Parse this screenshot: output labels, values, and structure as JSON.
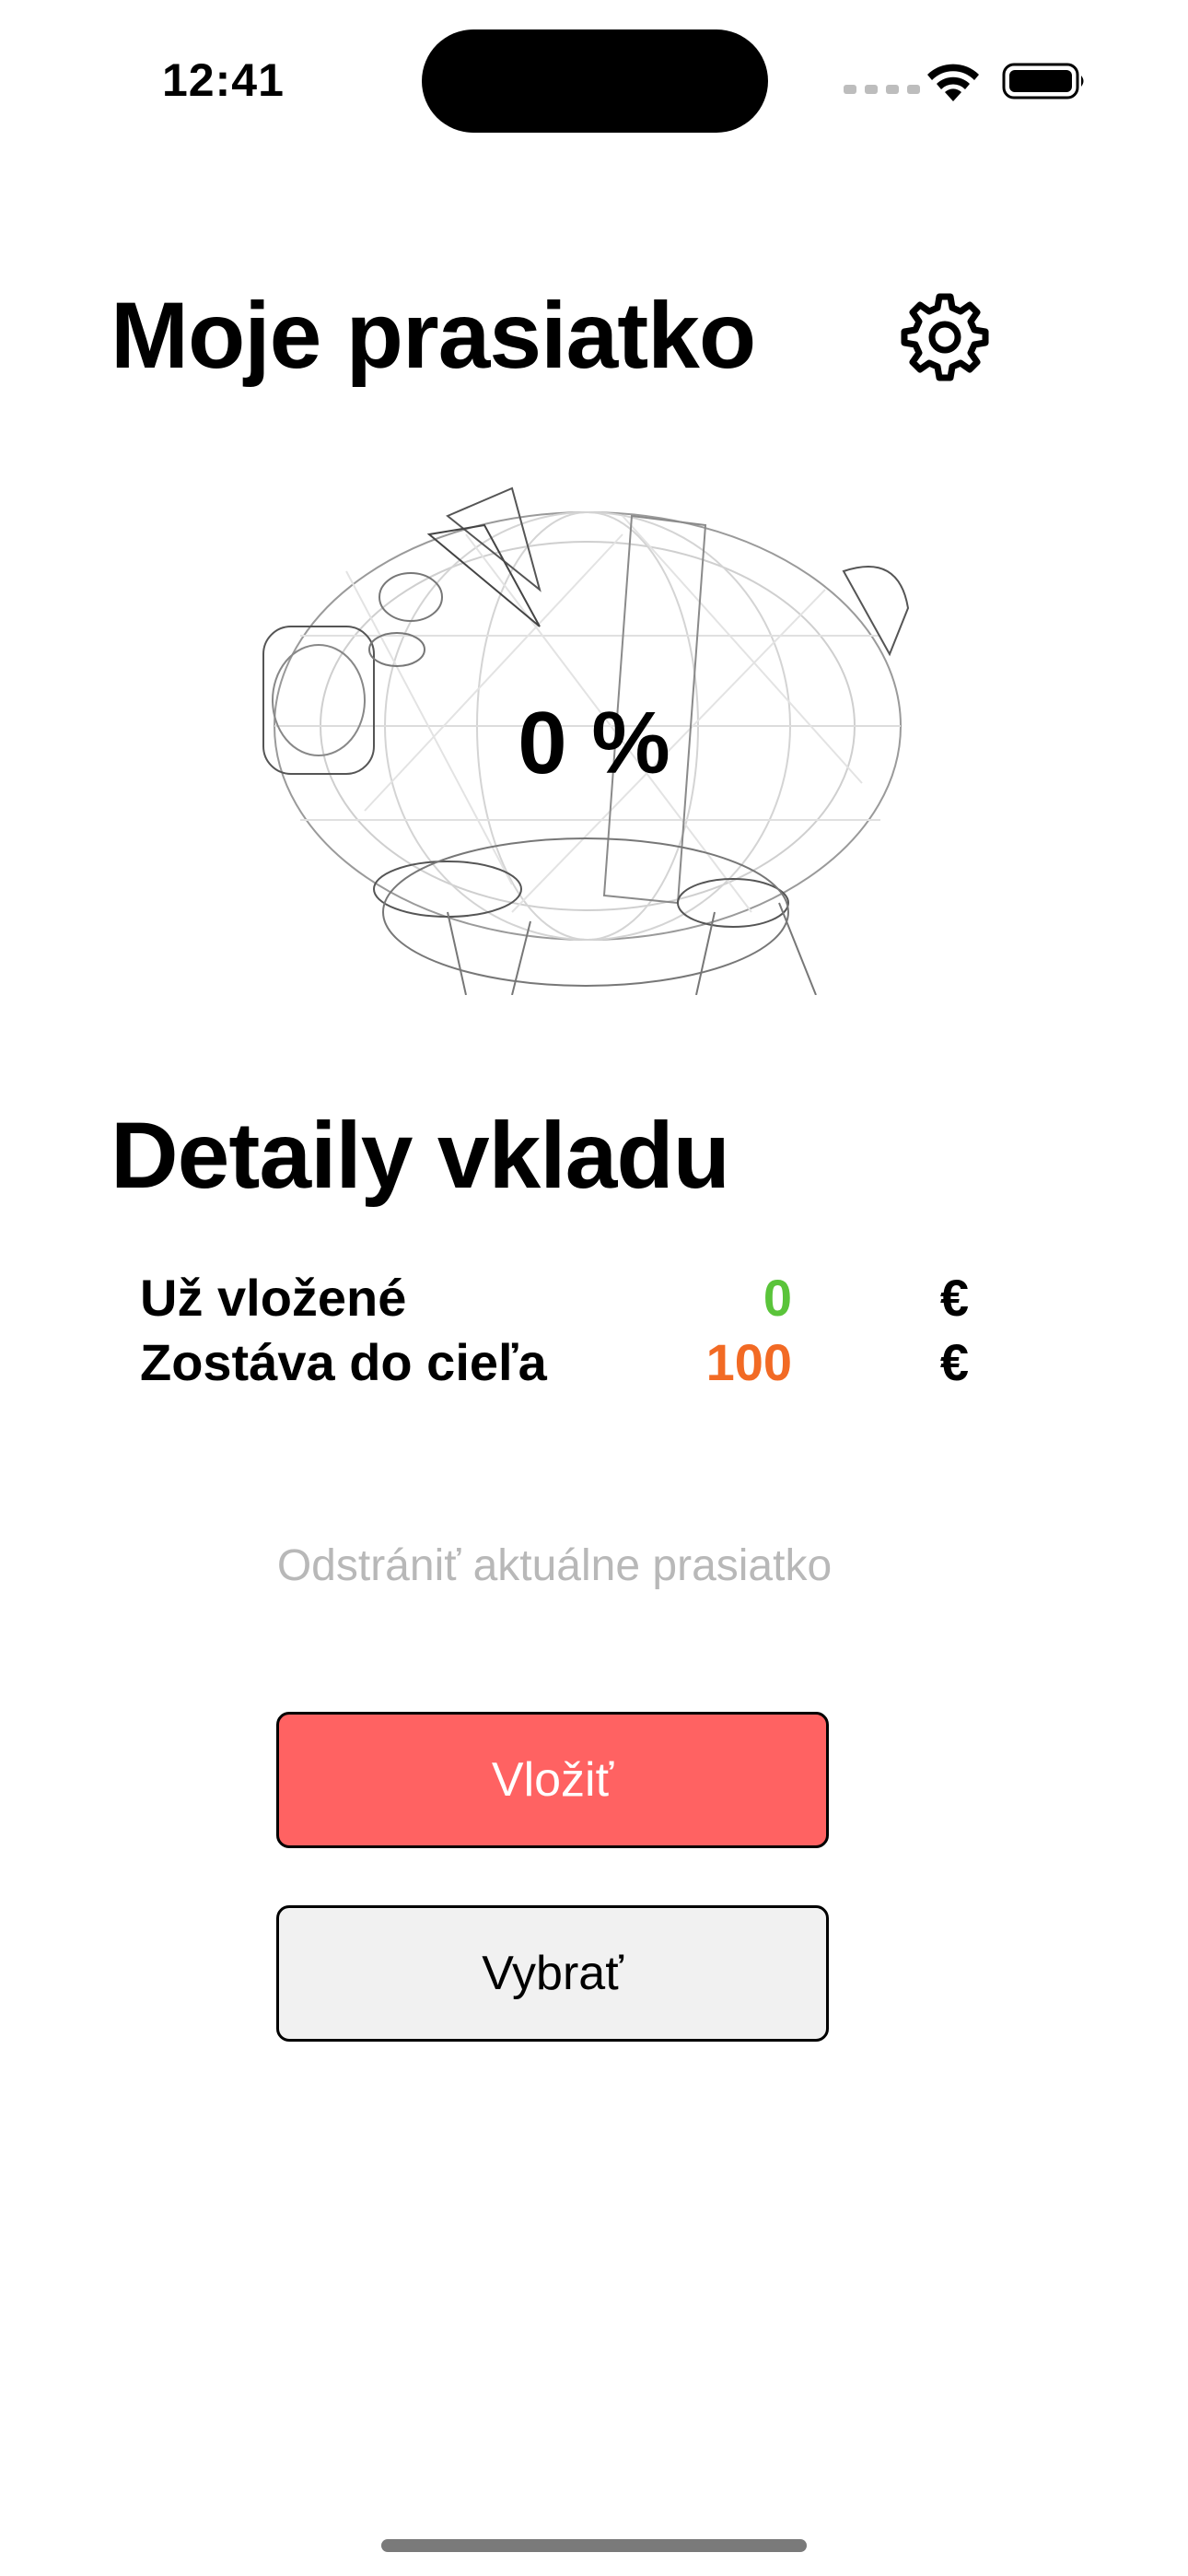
{
  "status_bar": {
    "time": "12:41"
  },
  "header": {
    "title": "Moje prasiatko",
    "settings_icon": "gear-icon"
  },
  "piggy": {
    "image": "piggy-bank-wireframe",
    "progress_label": "0 %",
    "progress": 0
  },
  "details": {
    "heading": "Detaily vkladu",
    "rows": [
      {
        "label": "Už vložené",
        "value": "0",
        "currency": "€",
        "color": "#5ac43a"
      },
      {
        "label": "Zostáva do cieľa",
        "value": "100",
        "currency": "€",
        "color": "#f26a24"
      }
    ]
  },
  "actions": {
    "remove_label": "Odstrániť aktuálne prasiatko",
    "deposit_label": "Vložiť",
    "withdraw_label": "Vybrať"
  },
  "colors": {
    "deposit_button": "#ff6262",
    "withdraw_button": "#f1f1f1"
  }
}
